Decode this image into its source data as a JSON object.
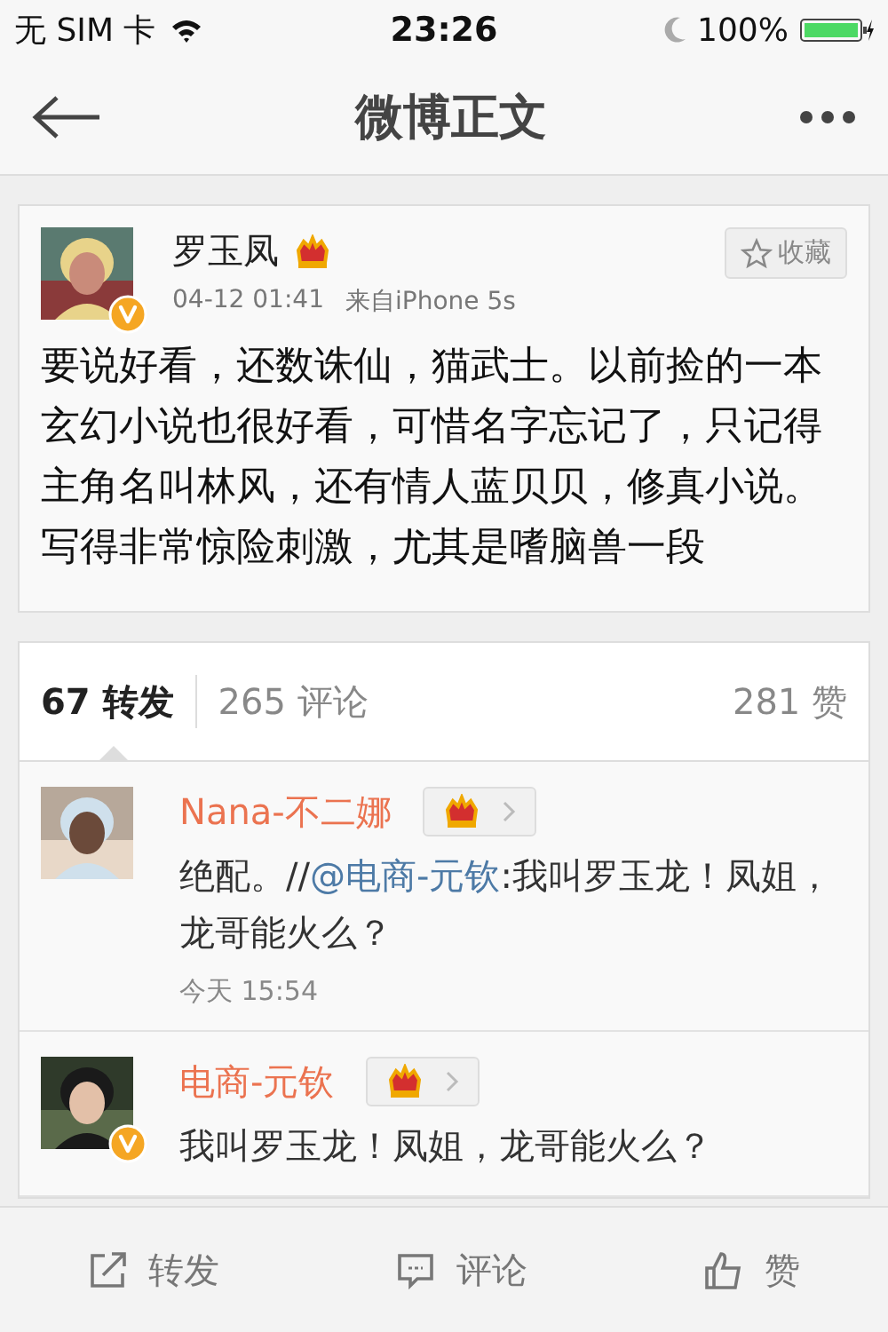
{
  "status_bar": {
    "carrier": "无 SIM 卡",
    "time": "23:26",
    "battery": "100%"
  },
  "nav": {
    "title": "微博正文"
  },
  "post": {
    "author": "罗玉凤",
    "verified": true,
    "time": "04-12 01:41",
    "source": "来自iPhone 5s",
    "favorite_button": "收藏",
    "text": "要说好看，还数诛仙，猫武士。以前捡的一本玄幻小说也很好看，可惜名字忘记了，只记得主角名叫林风，还有情人蓝贝贝，修真小说。写得非常惊险刺激，尤其是嗜脑兽一段"
  },
  "tabs": [
    {
      "count": "67",
      "label": "转发",
      "selected": true
    },
    {
      "count": "265",
      "label": "评论",
      "selected": false
    },
    {
      "count": "281",
      "label": "赞",
      "selected": false
    }
  ],
  "comments": [
    {
      "author": "Nana-不二娜",
      "verified": false,
      "text_before": "绝配。//",
      "mention": "@电商-元钦",
      "text_after": ":我叫罗玉龙！凤姐，龙哥能火么？",
      "time": "今天 15:54"
    },
    {
      "author": "电商-元钦",
      "verified": true,
      "text_before": "我叫罗玉龙！凤姐，龙哥能火么？"
    }
  ],
  "toolbar": [
    {
      "kind": "repost",
      "label": "转发"
    },
    {
      "kind": "comment",
      "label": "评论"
    },
    {
      "kind": "like",
      "label": "赞"
    }
  ]
}
